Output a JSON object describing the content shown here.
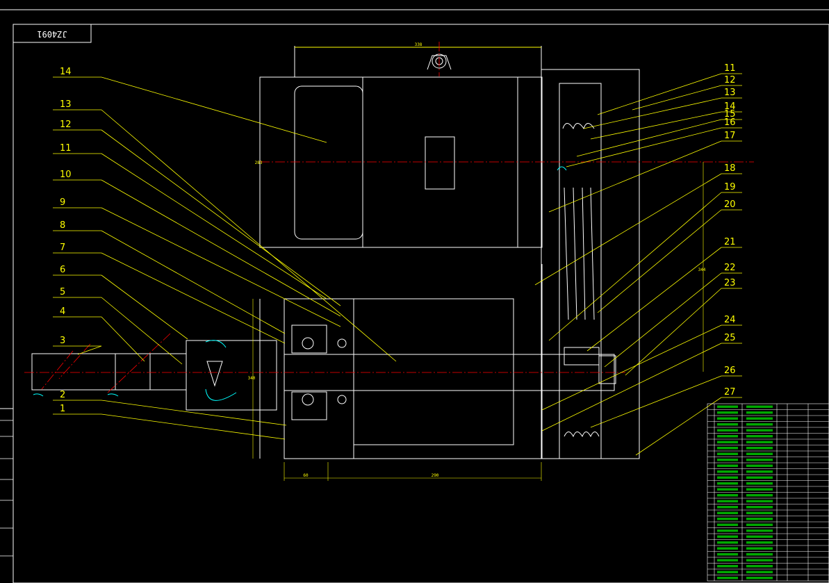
{
  "title_stamp": "JZ4091",
  "part_labels": [
    "1",
    "2",
    "3",
    "4",
    "5",
    "6",
    "7",
    "8",
    "9",
    "10",
    "11",
    "12",
    "13",
    "14",
    "11",
    "12",
    "13",
    "14",
    "15",
    "16",
    "17",
    "18",
    "19",
    "20",
    "21",
    "22",
    "23",
    "24",
    "25",
    "26",
    "27"
  ],
  "dimensions": {
    "top_width": "338",
    "motor_height": "283",
    "right_height": "344",
    "left_height": "340",
    "bottom_left": "60",
    "bottom_right": "290"
  },
  "bom_rows": 30,
  "colors": {
    "background": "#000000",
    "outline": "#ffffff",
    "leader": "#ffff00",
    "centerline": "#ff0000",
    "bom": "#00ff00",
    "section": "#00ffff"
  }
}
